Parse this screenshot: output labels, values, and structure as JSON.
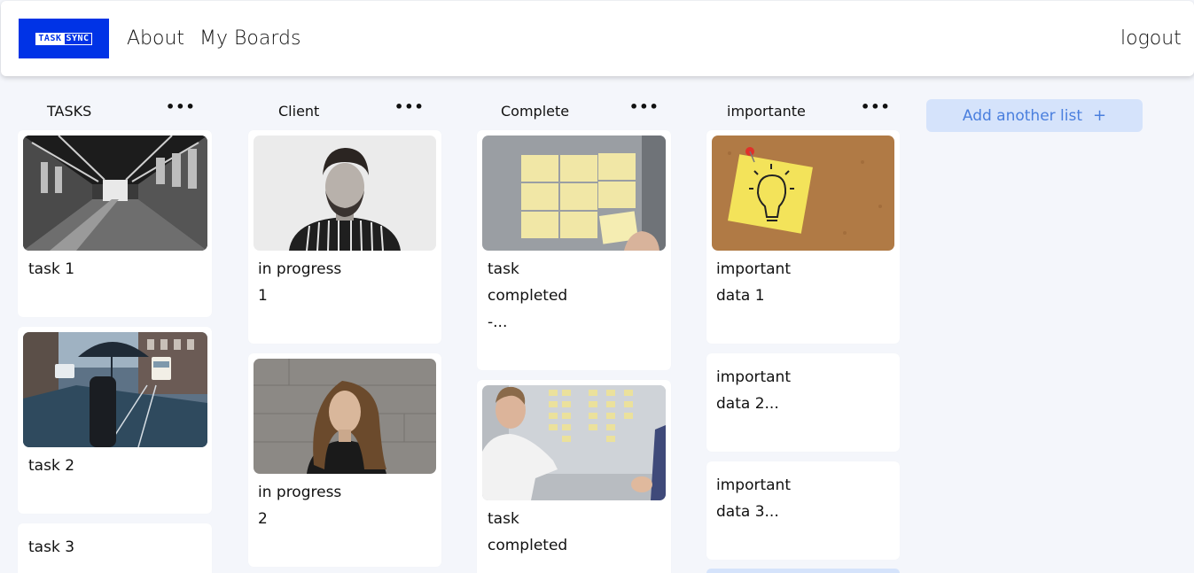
{
  "brand": {
    "logo_part1": "TASK",
    "logo_part2": "SYNC",
    "color": "#0033e6"
  },
  "nav": {
    "about": "About",
    "my_boards": "My Boards",
    "logout": "logout"
  },
  "lists": [
    {
      "title": "TASKS",
      "menu": "•••",
      "cards": [
        {
          "line1": "task 1",
          "line2": "",
          "line3": "",
          "image": "abandoned-factory-photo"
        },
        {
          "line1": "task 2",
          "line2": "",
          "line3": "",
          "image": "umbrella-street-photo"
        },
        {
          "line1": "task 3",
          "line2": "",
          "line3": "",
          "image": ""
        }
      ]
    },
    {
      "title": "Client",
      "menu": "•••",
      "cards": [
        {
          "line1": "in progress",
          "line2": "1",
          "line3": "",
          "image": "man-portrait-photo"
        },
        {
          "line1": "in progress",
          "line2": "2",
          "line3": "",
          "image": "woman-portrait-photo"
        }
      ]
    },
    {
      "title": "Complete",
      "menu": "•••",
      "cards": [
        {
          "line1": "task",
          "line2": "completed",
          "line3": "-...",
          "image": "sticky-notes-wall-photo"
        },
        {
          "line1": "task",
          "line2": "completed",
          "line3": "",
          "image": "whiteboard-team-photo"
        }
      ]
    },
    {
      "title": "importante",
      "menu": "•••",
      "cards": [
        {
          "line1": "important",
          "line2": "data 1",
          "line3": "",
          "image": "lightbulb-note-photo"
        },
        {
          "line1": "important",
          "line2": "data 2...",
          "line3": "",
          "image": ""
        },
        {
          "line1": "important",
          "line2": "data 3...",
          "line3": "",
          "image": ""
        }
      ]
    }
  ],
  "add_list": {
    "label": "Add another list",
    "icon": "+"
  }
}
